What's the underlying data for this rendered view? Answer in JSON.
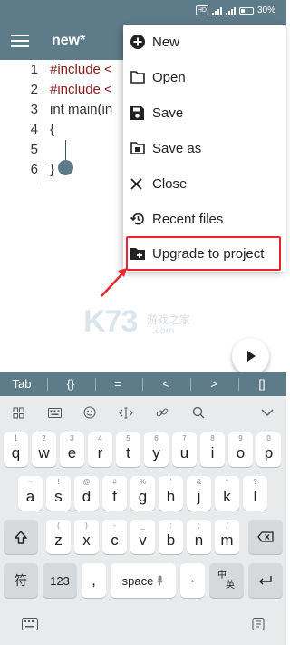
{
  "status": {
    "hd_label": "HD",
    "battery": "30%"
  },
  "toolbar": {
    "title": "new*"
  },
  "editor": {
    "line_numbers": [
      "1",
      "2",
      "3",
      "4",
      "5",
      "6"
    ],
    "lines": [
      "#include <",
      "#include <",
      "int main(in",
      "{",
      "",
      "}"
    ]
  },
  "menu": {
    "items": [
      {
        "label": "New",
        "icon": "plus-circle-icon"
      },
      {
        "label": "Open",
        "icon": "folder-icon"
      },
      {
        "label": "Save",
        "icon": "save-icon"
      },
      {
        "label": "Save as",
        "icon": "save-as-icon"
      },
      {
        "label": "Close",
        "icon": "close-icon"
      },
      {
        "label": "Recent files",
        "icon": "history-icon"
      },
      {
        "label": "Upgrade to project",
        "icon": "folder-plus-icon"
      }
    ],
    "highlight_color": "#e8262c"
  },
  "watermark": {
    "brand": "K73",
    "cn": "游戏之家",
    "domain": ".com"
  },
  "shortcuts": [
    "Tab",
    "{}",
    "=",
    "<",
    ">",
    "[]"
  ],
  "keyboard": {
    "row1": [
      "q",
      "w",
      "e",
      "r",
      "t",
      "y",
      "u",
      "i",
      "o",
      "p"
    ],
    "row1_hints": [
      "1",
      "2",
      "3",
      "4",
      "5",
      "6",
      "7",
      "8",
      "9",
      "0"
    ],
    "row2": [
      "a",
      "s",
      "d",
      "f",
      "g",
      "h",
      "j",
      "k",
      "l"
    ],
    "row2_hints": [
      "~",
      "!",
      "@",
      "#",
      "%",
      "'",
      "&",
      "*",
      "?"
    ],
    "row3": [
      "z",
      "x",
      "c",
      "v",
      "b",
      "n",
      "m"
    ],
    "row3_hints": [
      "(",
      ")",
      "-",
      "_",
      ":",
      ";",
      "/"
    ],
    "sym_key": "符",
    "num_key": "123",
    "comma": ",",
    "space": "space",
    "period": "·",
    "lang_top": "中",
    "lang_bottom": "英"
  },
  "colors": {
    "primary": "#5e7b8a",
    "keyboard_bg": "#e8eaec"
  }
}
